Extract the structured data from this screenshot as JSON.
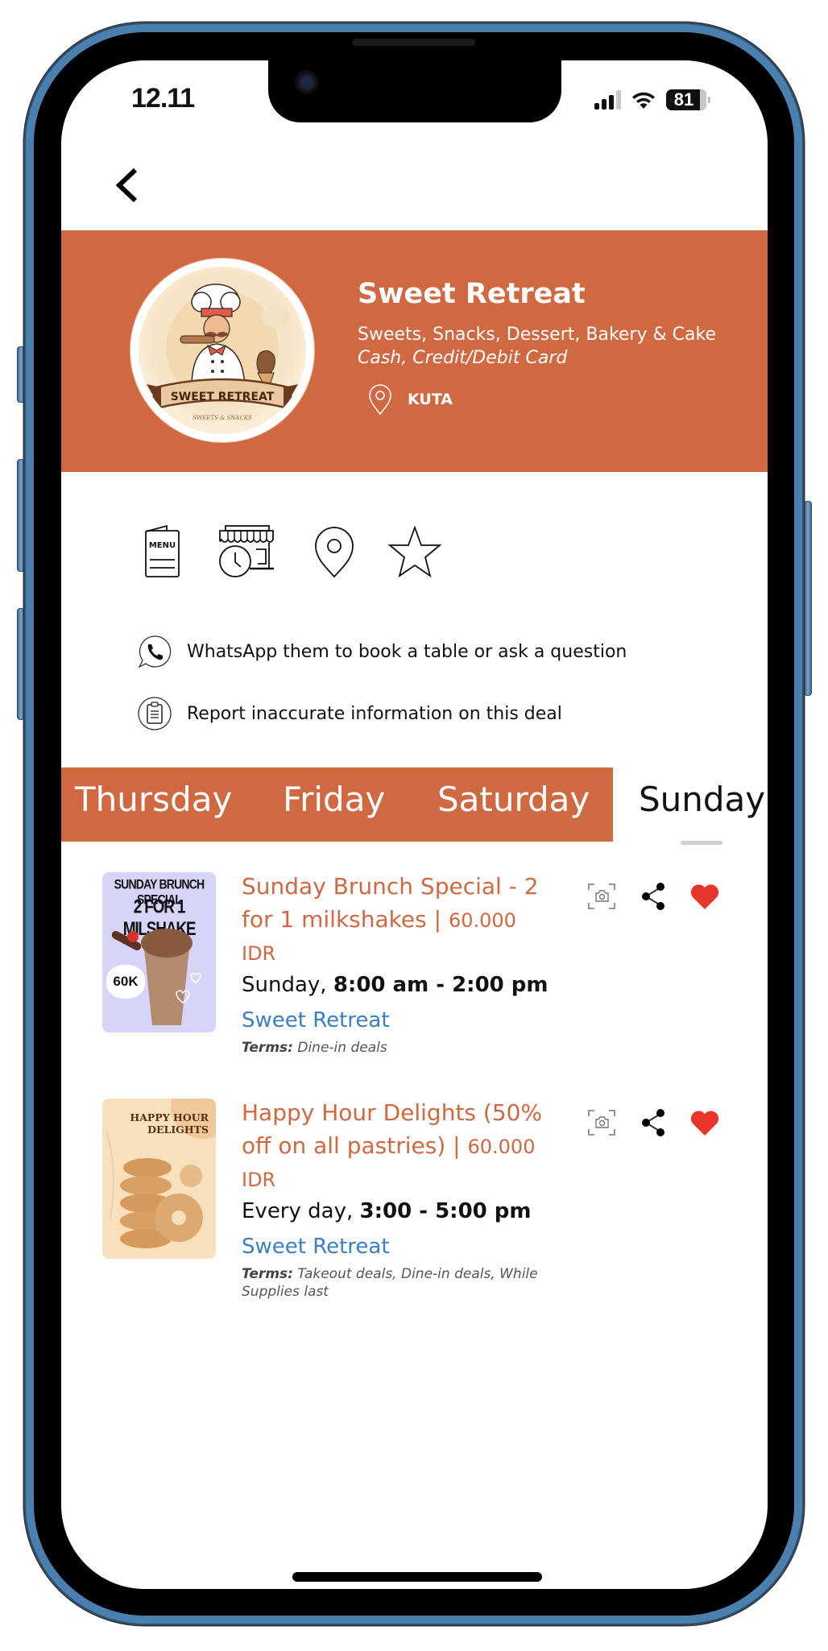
{
  "status_bar": {
    "time": "12.11",
    "battery_percent": "81",
    "signal_bars_active": 3,
    "signal_bars_total": 4
  },
  "navigation": {
    "back_icon": "chevron-left-icon"
  },
  "restaurant": {
    "name": "Sweet Retreat",
    "categories": "Sweets, Snacks, Dessert, Bakery & Cake",
    "payment": "Cash, Credit/Debit Card",
    "location": "KUTA",
    "logo_text": "SWEET RETREAT",
    "logo_subtext": "SWEETS & SNACKS"
  },
  "quick_actions": [
    {
      "icon": "menu-icon",
      "label": "MENU"
    },
    {
      "icon": "store-hours-icon"
    },
    {
      "icon": "map-pin-icon"
    },
    {
      "icon": "star-icon"
    }
  ],
  "info_links": {
    "whatsapp": "WhatsApp them to book a table or ask a question",
    "report": "Report inaccurate information on this deal"
  },
  "day_tabs": [
    {
      "label": "Thursday",
      "active": false
    },
    {
      "label": "Friday",
      "active": false
    },
    {
      "label": "Saturday",
      "active": false
    },
    {
      "label": "Sunday",
      "active": true
    }
  ],
  "deals": [
    {
      "title": "Sunday Brunch Special - 2 for 1 milkshakes |",
      "price": "60.000",
      "currency": "IDR",
      "day": "Sunday,",
      "hours": "8:00 am - 2:00 pm",
      "restaurant": "Sweet Retreat",
      "terms_label": "Terms:",
      "terms": "Dine-in deals",
      "favorited": true,
      "thumb_line1": "SUNDAY BRUNCH SPECIAL",
      "thumb_line2": "2 FOR 1 MILSHAKE",
      "thumb_badge": "60K"
    },
    {
      "title": "Happy Hour Delights (50% off on all pastries) |",
      "price": "60.000",
      "currency": "IDR",
      "day": "Every day,",
      "hours": "3:00 - 5:00 pm",
      "restaurant": "Sweet Retreat",
      "terms_label": "Terms:",
      "terms": "Takeout deals, Dine-in deals, While Supplies last",
      "favorited": true,
      "thumb_line1": "HAPPY HOUR DELIGHTS"
    }
  ],
  "colors": {
    "brand": "#d06841",
    "link": "#3a7fc4",
    "favorite": "#e8352a",
    "text": "#111111"
  }
}
